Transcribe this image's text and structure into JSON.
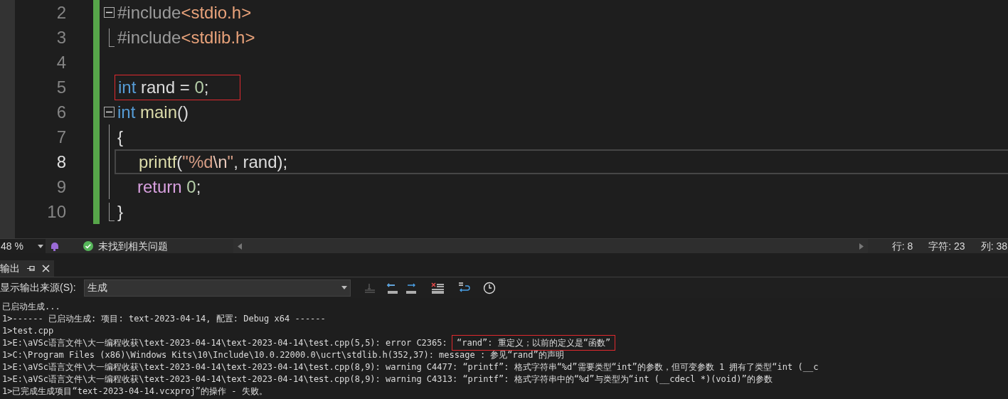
{
  "editor": {
    "lines": [
      {
        "number": "2",
        "current": false,
        "kind": "fold-start",
        "highlighted": false,
        "indented": false,
        "tokens": [
          {
            "text": "#include",
            "kind": "preprocessor"
          },
          {
            "text": "<stdio.h>",
            "kind": "include-path"
          }
        ]
      },
      {
        "number": "3",
        "current": false,
        "kind": "fold-end",
        "highlighted": false,
        "indented": false,
        "tokens": [
          {
            "text": "#include",
            "kind": "preprocessor"
          },
          {
            "text": "<stdlib.h>",
            "kind": "include-path"
          }
        ]
      },
      {
        "number": "4",
        "current": false,
        "kind": "blank"
      },
      {
        "number": "5",
        "current": false,
        "kind": "blank",
        "highlighted": true,
        "indented": false,
        "tokens": [
          {
            "text": "int",
            "kind": "keyword"
          },
          {
            "text": " rand = ",
            "kind": "plain"
          },
          {
            "text": "0",
            "kind": "number"
          },
          {
            "text": ";",
            "kind": "plain"
          }
        ]
      },
      {
        "number": "6",
        "current": false,
        "kind": "fold-start",
        "highlighted": false,
        "indented": false,
        "tokens": [
          {
            "text": "int",
            "kind": "keyword"
          },
          {
            "text": " main",
            "kind": "function"
          },
          {
            "text": "()",
            "kind": "plain"
          }
        ]
      },
      {
        "number": "7",
        "current": false,
        "kind": "fold-body",
        "highlighted": false,
        "indented": false,
        "tokens": [
          {
            "text": "{",
            "kind": "plain"
          }
        ]
      },
      {
        "number": "8",
        "current": true,
        "kind": "fold-body",
        "highlighted": false,
        "indented": true,
        "tokens": [
          {
            "text": "printf",
            "kind": "function"
          },
          {
            "text": "(",
            "kind": "plain"
          },
          {
            "text": "\"%d",
            "kind": "string"
          },
          {
            "text": "\\n",
            "kind": "escape"
          },
          {
            "text": "\"",
            "kind": "string"
          },
          {
            "text": ", rand);",
            "kind": "plain"
          }
        ]
      },
      {
        "number": "9",
        "current": false,
        "kind": "fold-body",
        "highlighted": false,
        "indented": true,
        "tokens": [
          {
            "text": "return",
            "kind": "control"
          },
          {
            "text": " 0",
            "kind": "number"
          },
          {
            "text": ";",
            "kind": "plain"
          }
        ]
      },
      {
        "number": "10",
        "current": false,
        "kind": "fold-end",
        "highlighted": false,
        "indented": false,
        "tokens": [
          {
            "text": "}",
            "kind": "plain"
          }
        ]
      }
    ]
  },
  "status_bar": {
    "zoom": "48 %",
    "issues": "未找到相关问题",
    "line": "行: 8",
    "char": "字符: 23",
    "column": "列: 38"
  },
  "output": {
    "tab": "输出",
    "source_label": "显示输出来源(S):",
    "source": "生成",
    "lines": [
      {
        "text": "已启动生成..."
      },
      {
        "text": "1>------ 已启动生成: 项目: text-2023-04-14, 配置: Debug x64 ------"
      },
      {
        "text": "1>test.cpp"
      },
      {
        "text": "1>E:\\aVSc语言文件\\大一编程收获\\text-2023-04-14\\text-2023-04-14\\test.cpp(5,5): error C2365: ",
        "highlight": "“rand”: 重定义；以前的定义是“函数”"
      },
      {
        "text": "1>C:\\Program Files (x86)\\Windows Kits\\10\\Include\\10.0.22000.0\\ucrt\\stdlib.h(352,37): message : 参见“rand”的声明"
      },
      {
        "text": "1>E:\\aVSc语言文件\\大一编程收获\\text-2023-04-14\\text-2023-04-14\\test.cpp(8,9): warning C4477: “printf”: 格式字符串“%d”需要类型“int”的参数，但可变参数 1 拥有了类型“int (__c"
      },
      {
        "text": "1>E:\\aVSc语言文件\\大一编程收获\\text-2023-04-14\\text-2023-04-14\\test.cpp(8,9): warning C4313: “printf”: 格式字符串中的“%d”与类型为“int (__cdecl *)(void)”的参数"
      },
      {
        "text": "1>已完成生成项目“text-2023-04-14.vcxproj”的操作 - 失败。"
      }
    ]
  }
}
